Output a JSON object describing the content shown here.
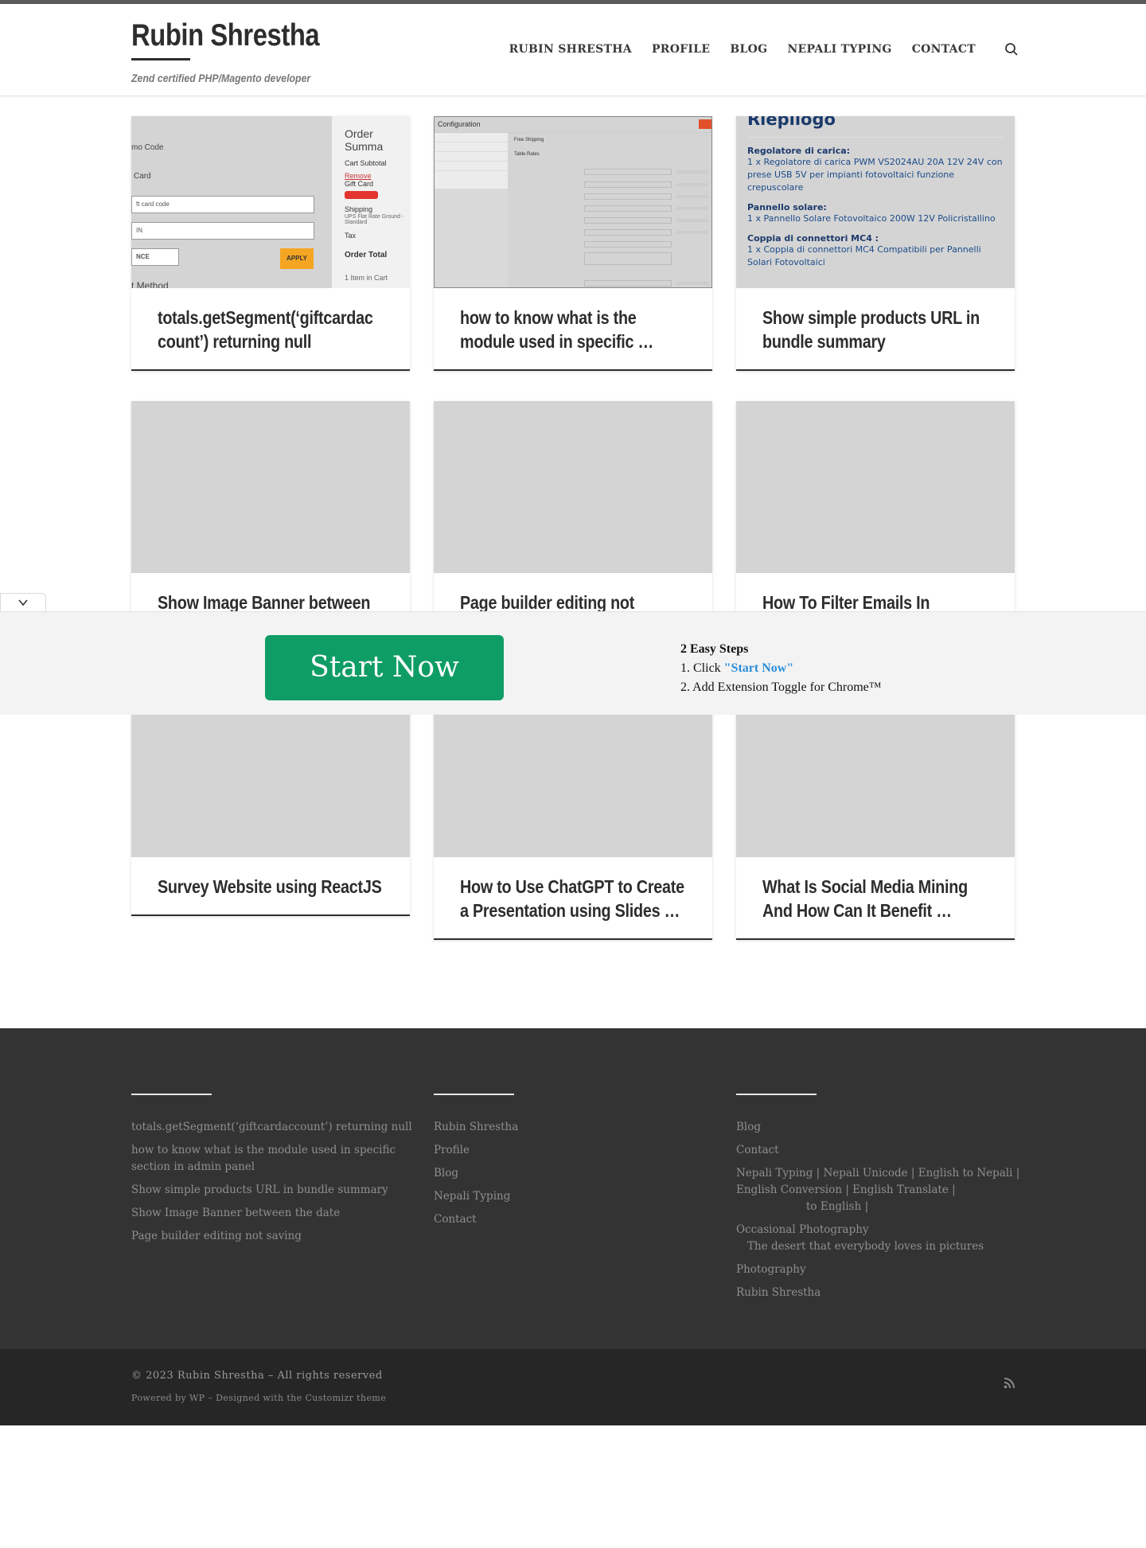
{
  "header": {
    "site_title": "Rubin Shrestha",
    "tagline": "Zend certified PHP/Magento developer",
    "nav": [
      "RUBIN SHRESTHA",
      "PROFILE",
      "BLOG",
      "NEPALI TYPING",
      "CONTACT"
    ],
    "search_icon": "search-icon"
  },
  "posts": [
    {
      "title": "totals.getSegment(‘giftcardac count’) returning null"
    },
    {
      "title": "how to know what is the module used in specific …"
    },
    {
      "title": "Show simple products URL in bundle summary"
    },
    {
      "title": "Show Image Banner between"
    },
    {
      "title": "Page builder editing not saving"
    },
    {
      "title": "How To Filter Emails In Hotmail"
    },
    {
      "title": "Survey Website using ReactJS"
    },
    {
      "title": "How to Use ChatGPT to Create a Presentation using Slides …"
    },
    {
      "title": "What Is Social Media Mining And How Can It Benefit …"
    }
  ],
  "thumb1": {
    "promo": "mo Code",
    "card": "Card",
    "gift_placeholder": "ft card code",
    "pin_placeholder": "IN",
    "ince": "NCE",
    "apply": "APPLY",
    "method": "t Method",
    "summary": "Order Summa",
    "subtotal": "Cart Subtotal",
    "remove": "Remove",
    "gift": "Gift Card",
    "shipping": "Shipping",
    "shipping_desc": "UPS Flat Rate Ground - Standard",
    "tax": "Tax",
    "order_total": "Order Total",
    "items": "1 Item in Cart"
  },
  "thumb2": {
    "title": "Configuration",
    "section": "Free Shipping",
    "rates": "Table Rates"
  },
  "thumb3": {
    "heading": "Riepilogo",
    "groups": [
      {
        "label": "Regolatore di carica:",
        "text": "1 x Regolatore di carica PWM VS2024AU 20A 12V 24V con prese USB 5V per impianti fotovoltaici funzione crepuscolare"
      },
      {
        "label": "Pannello solare:",
        "text": "1 x Pannello Solare Fotovoltaico 200W 12V Policristallino"
      },
      {
        "label": "Coppia di connettori MC4 :",
        "text": "1 x Coppia di connettori MC4 Compatibili per Pannelli Solari Fotovoltaici"
      }
    ]
  },
  "overlay": {
    "button": "Start Now",
    "steps_title": "2 Easy Steps",
    "step1_prefix": "1. Click ",
    "step1_link": "\"Start Now\"",
    "step2": "2. Add Extension Toggle for Chrome™"
  },
  "footer": {
    "col1": [
      "totals.getSegment(‘giftcardaccount’) returning null",
      "how to know what is the module used in specific section in admin panel",
      "Show simple products URL in bundle summary",
      "Show Image Banner between the date",
      "Page builder editing not saving"
    ],
    "col2": [
      "Rubin Shrestha",
      "Profile",
      "Blog",
      "Nepali Typing",
      "Contact"
    ],
    "col3": {
      "blog": "Blog",
      "contact": "Contact",
      "typing": "Nepali Typing | Nepali Unicode | English to Nepali | English Conversion | English Translate |",
      "typing_sub": "to English |",
      "photo": "Occasional Photography",
      "photo_sub": "The desert that everybody loves in pictures",
      "photography": "Photography",
      "rubin": "Rubin Shrestha"
    },
    "copyright": "© 2023 Rubin Shrestha – All rights reserved",
    "powered": "Powered by WP – Designed with the Customizr theme"
  }
}
